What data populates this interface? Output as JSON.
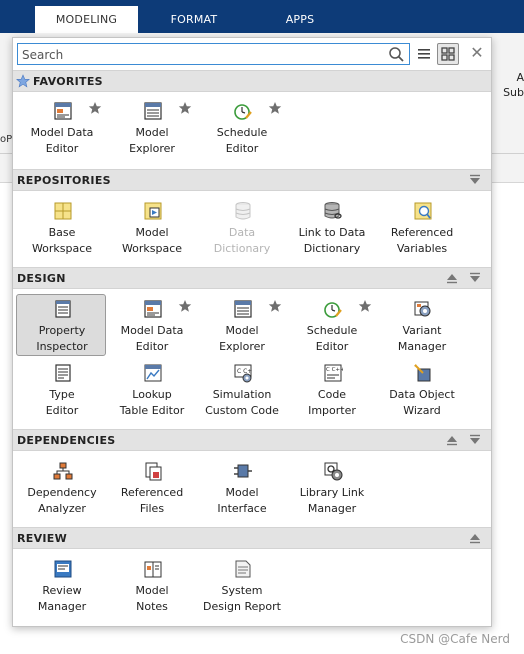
{
  "tabs": [
    {
      "label": "MODELING",
      "active": true
    },
    {
      "label": "FORMAT",
      "active": false
    },
    {
      "label": "APPS",
      "active": false
    }
  ],
  "background": {
    "left_fragment": "oPo",
    "right_fragment_1": "A",
    "right_fragment_2": "Sub"
  },
  "search": {
    "placeholder": "Search",
    "value": ""
  },
  "sections": {
    "favorites": {
      "title": "FAVORITES"
    },
    "repositories": {
      "title": "REPOSITORIES"
    },
    "design": {
      "title": "DESIGN"
    },
    "dependencies": {
      "title": "DEPENDENCIES"
    },
    "review": {
      "title": "REVIEW"
    }
  },
  "favorites": [
    {
      "label": "Model Data\nEditor",
      "icon": "model-data-editor-icon",
      "starred": true
    },
    {
      "label": "Model\nExplorer",
      "icon": "model-explorer-icon",
      "starred": true
    },
    {
      "label": "Schedule\nEditor",
      "icon": "schedule-editor-icon",
      "starred": true
    }
  ],
  "repositories": [
    {
      "label": "Base\nWorkspace",
      "icon": "base-workspace-icon",
      "disabled": false
    },
    {
      "label": "Model\nWorkspace",
      "icon": "model-workspace-icon",
      "disabled": false
    },
    {
      "label": "Data\nDictionary",
      "icon": "data-dictionary-icon",
      "disabled": true
    },
    {
      "label": "Link to Data\nDictionary",
      "icon": "link-data-dictionary-icon",
      "disabled": false
    },
    {
      "label": "Referenced\nVariables",
      "icon": "referenced-variables-icon",
      "disabled": false
    }
  ],
  "design": [
    {
      "label": "Property\nInspector",
      "icon": "property-inspector-icon",
      "selected": true,
      "starred": false
    },
    {
      "label": "Model Data\nEditor",
      "icon": "model-data-editor-icon",
      "starred": true
    },
    {
      "label": "Model\nExplorer",
      "icon": "model-explorer-icon",
      "starred": true
    },
    {
      "label": "Schedule\nEditor",
      "icon": "schedule-editor-icon",
      "starred": true
    },
    {
      "label": "Variant\nManager",
      "icon": "variant-manager-icon",
      "starred": false
    },
    {
      "label": "Type\nEditor",
      "icon": "type-editor-icon",
      "starred": false
    },
    {
      "label": "Lookup\nTable Editor",
      "icon": "lookup-table-editor-icon",
      "starred": false
    },
    {
      "label": "Simulation\nCustom Code",
      "icon": "simulation-custom-code-icon",
      "starred": false
    },
    {
      "label": "Code\nImporter",
      "icon": "code-importer-icon",
      "starred": false
    },
    {
      "label": "Data Object\nWizard",
      "icon": "data-object-wizard-icon",
      "starred": false
    }
  ],
  "dependencies": [
    {
      "label": "Dependency\nAnalyzer",
      "icon": "dependency-analyzer-icon"
    },
    {
      "label": "Referenced\nFiles",
      "icon": "referenced-files-icon"
    },
    {
      "label": "Model\nInterface",
      "icon": "model-interface-icon"
    },
    {
      "label": "Library Link\nManager",
      "icon": "library-link-manager-icon"
    }
  ],
  "review": [
    {
      "label": "Review\nManager",
      "icon": "review-manager-icon"
    },
    {
      "label": "Model\nNotes",
      "icon": "model-notes-icon"
    },
    {
      "label": "System\nDesign Report",
      "icon": "system-design-report-icon"
    }
  ],
  "watermark": "CSDN @Cafe Nerd",
  "colors": {
    "tabbar": "#0d3b78",
    "accent": "#3b8bd4",
    "star": "#6f6f6f",
    "section": "#e3e3e3"
  }
}
